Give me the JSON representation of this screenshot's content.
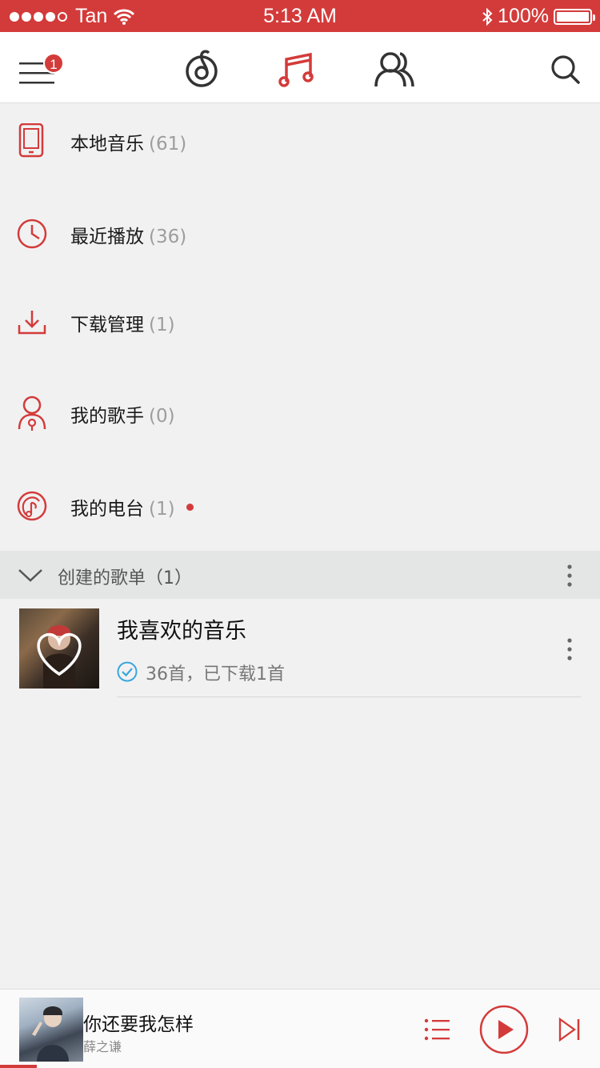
{
  "status_bar": {
    "carrier": "Tan",
    "time": "5:13 AM",
    "battery": "100%"
  },
  "nav": {
    "badge_count": "1",
    "tabs": [
      "netease-logo-icon",
      "music-note-icon",
      "friends-icon"
    ],
    "active_tab": "music-note-icon"
  },
  "menu": [
    {
      "label": "本地音乐",
      "count": "(61)",
      "icon": "phone-icon"
    },
    {
      "label": "最近播放",
      "count": "(36)",
      "icon": "clock-icon"
    },
    {
      "label": "下载管理",
      "count": "(1)",
      "icon": "download-icon"
    },
    {
      "label": "我的歌手",
      "count": "(0)",
      "icon": "singer-icon"
    },
    {
      "label": "我的电台",
      "count": "(1)",
      "icon": "radio-icon",
      "has_new_dot": true
    }
  ],
  "section": {
    "title": "创建的歌单（1）"
  },
  "playlist": {
    "title": "我喜欢的音乐",
    "subtitle": "36首，已下载1首"
  },
  "now_playing": {
    "title": "你还要我怎样",
    "artist": "薛之谦",
    "progress": 0.06
  },
  "colors": {
    "accent": "#d33b3a",
    "background": "#f1f1f2",
    "section_bg": "#e4e6e6"
  }
}
